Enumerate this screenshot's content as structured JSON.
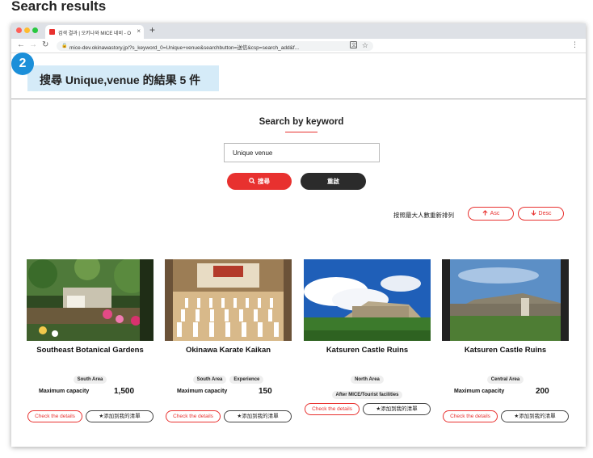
{
  "page_heading": "Search results",
  "browser": {
    "tab_title": "검색 결과 | 오키나와 MICE 네비 - O",
    "tab_close": "×",
    "new_tab": "+",
    "url": "mice-dev.okinawastory.jp/?s_keyword_0=Unique+venue&searchbutton=送信&csp=search_add&f..."
  },
  "annotation": {
    "step": "2"
  },
  "banner": {
    "text": "搜尋 Unique,venue 的結果 5 件"
  },
  "search": {
    "title": "Search by keyword",
    "input_value": "Unique venue",
    "search_button": "搜尋",
    "reset_button": "重啟"
  },
  "sort": {
    "label": "按照最大人數重新排列",
    "asc": "Asc",
    "desc": "Desc"
  },
  "cards": [
    {
      "name": "Southeast Botanical Gardens",
      "tags": [
        "South Area"
      ],
      "capacity_label": "Maximum capacity",
      "capacity": "1,500",
      "details": "Check the details",
      "add": "★添加到我的清單"
    },
    {
      "name": "Okinawa Karate Kaikan",
      "tags": [
        "South Area",
        "Experience"
      ],
      "capacity_label": "Maximum capacity",
      "capacity": "150",
      "details": "Check the details",
      "add": "★添加到我的清單"
    },
    {
      "name": "Katsuren Castle Ruins",
      "tags": [
        "North Area",
        "After MICE/Tourist facilities"
      ],
      "details": "Check the details",
      "add": "★添加到我的清單"
    },
    {
      "name": "Katsuren Castle Ruins",
      "tags": [
        "Central Area"
      ],
      "capacity_label": "Maximum capacity",
      "capacity": "200",
      "details": "Check the details",
      "add": "★添加到我的清單"
    }
  ],
  "colors": {
    "accent": "#e8312f",
    "annotation": "#1b8fd9",
    "banner_bg": "#d5ebf8",
    "dark_button": "#2b2b2b"
  }
}
